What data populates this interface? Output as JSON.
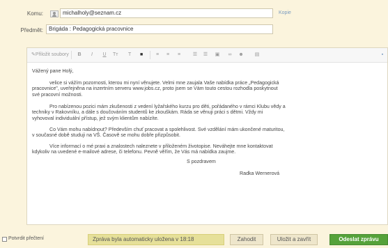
{
  "header": {
    "to_label": "Komu:",
    "to_value": "michalholy@seznam.cz",
    "copy_link": "Kopie",
    "subject_label": "Předmět:",
    "subject_value": "Brigáda : Pedagogická pracovnice"
  },
  "toolbar": {
    "attach": "Přiložit soubory",
    "bold": "B",
    "italic": "I",
    "underline": "U",
    "font_size": "Tт",
    "text_color": "T",
    "bg_color": "■",
    "link_text": "∞"
  },
  "body": {
    "greeting": "Vážený pane Holý,",
    "p1_l1": "velice si vážím pozornosti, kterou mi nyní věnujete. Velmi mne zaujala Vaše nabídka práce „Pedagogická",
    "p1_l2": "pracovnice\", uveřejněna na inzertním serveru www.jobs.cz, proto jsem se Vám touto cestou rozhodla poskytnout",
    "p1_l3": "své pracovní možnosti.",
    "p2_l1": "Pro nabízenou pozici mám zkušenosti z vedení lyžařského kurzu pro děti, pořádaného v rámci Klubu vědy a",
    "p2_l2": "techniky v Rakovníku, a dále s doučováním studentů ke zkouškám. Ráda se věnuji práci s dětmi. Vždy mi",
    "p2_l3": "vyhovoval individuální přístup, jež svým klientům nabízíte.",
    "p3_l1": "Co Vám mohu nabídnout? Především chuť pracovat a spolehlivost. Své vzdělání mám ukončené maturitou,",
    "p3_l2": "v současné době studuji na VŠ. Časově se mohu dobře přizpůsobit.",
    "p4_l1": "Více informací o mé praxi a znalostech naleznete v přiloženém životopise. Neváhejte mne kontaktovat",
    "p4_l2": "kdykoliv na uvedené e-mailové adrese, či telefonu. Pevně věřím, že Vás má nabídka zaujme.",
    "closing": "S pozdravem",
    "signature": "Radka Wernerová"
  },
  "footer": {
    "confirm_read": "Potvrdit přečtení",
    "autosave_notice": "Zpráva byla automaticky uložena v 18:18",
    "discard": "Zahodit",
    "save_close": "Uložit a zavřít",
    "send": "Odeslat zprávu"
  },
  "colors": {
    "page_bg": "#fbf4dd",
    "send_button": "#55a23a",
    "notice_bg": "#e6e099"
  },
  "icons": [
    "contacts-icon",
    "attach-icon",
    "align-left-icon",
    "align-center-icon",
    "align-right-icon",
    "bullet-list-icon",
    "numbered-list-icon",
    "image-icon",
    "link-icon",
    "emoticon-icon"
  ]
}
